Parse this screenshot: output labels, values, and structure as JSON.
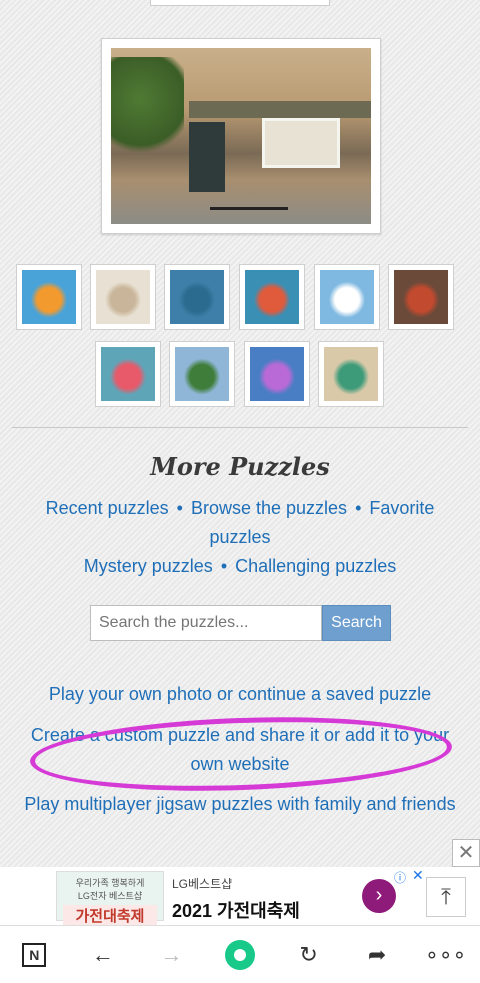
{
  "hero": {
    "alt": "Cotswold shop front with bicycle"
  },
  "thumbnails_row1": [
    {
      "name": "goldfish",
      "color": "#f29a2e",
      "bg": "#4aa3d8"
    },
    {
      "name": "street-houses",
      "color": "#c9b59a",
      "bg": "#e8e1d3"
    },
    {
      "name": "wreath-door",
      "color": "#2a6b8f",
      "bg": "#3d7fa8"
    },
    {
      "name": "boats",
      "color": "#e05a3c",
      "bg": "#3a8fb5"
    },
    {
      "name": "daisies",
      "color": "#ffffff",
      "bg": "#7fb8e0"
    },
    {
      "name": "carousel",
      "color": "#c24a2e",
      "bg": "#6b4a3a"
    }
  ],
  "thumbnails_row2": [
    {
      "name": "flower-house",
      "color": "#e85a6a",
      "bg": "#5fa5b8"
    },
    {
      "name": "mountain-lake",
      "color": "#3f7d3a",
      "bg": "#8fb6d6"
    },
    {
      "name": "cupcakes",
      "color": "#b96ad6",
      "bg": "#4a7ec4"
    },
    {
      "name": "green-doorway",
      "color": "#3e9b7a",
      "bg": "#d9c9a8"
    }
  ],
  "more": {
    "title": "More Puzzles",
    "recent": "Recent puzzles",
    "browse": "Browse the puzzles",
    "favorite": "Favorite puzzles",
    "mystery": "Mystery puzzles",
    "challenging": "Challenging puzzles",
    "bullet": "•"
  },
  "search": {
    "placeholder": "Search the puzzles...",
    "button": "Search"
  },
  "cta": {
    "own_photo": "Play your own photo or continue a saved puzzle",
    "custom_line1": "Create a custom puzzle and share it or add it to your",
    "custom_line2": "own website",
    "multiplayer": "Play multiplayer jigsaw puzzles with family and friends"
  },
  "ad": {
    "img_top": "우리가족 행복하게",
    "img_sub": "LG전자 베스트샵",
    "img_big": "가전대축제",
    "brand": "LG베스트샵",
    "headline": "2021 가전대축제",
    "go": "›",
    "info": "ⓘ",
    "close": "✕",
    "totop": "⤒",
    "close_outer": "✕"
  },
  "nav": {
    "n": "N",
    "back": "←",
    "forward": "→",
    "reload": "↻",
    "share": "➦",
    "more": "∘∘∘"
  }
}
